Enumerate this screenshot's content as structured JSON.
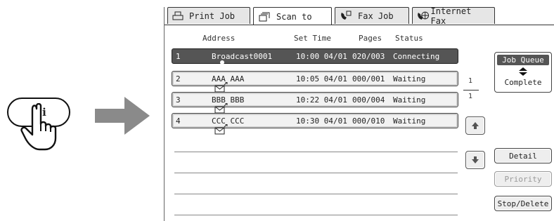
{
  "hint": {
    "dots": "··",
    "letter": "i"
  },
  "tabs": [
    {
      "label": "Print Job",
      "icon": "printer-icon"
    },
    {
      "label": "Scan to",
      "icon": "scanner-icon"
    },
    {
      "label": "Fax Job",
      "icon": "fax-icon"
    },
    {
      "label": "Internet Fax",
      "icon": "internet-fax-icon"
    }
  ],
  "columns": {
    "address": "Address",
    "set_time": "Set Time",
    "pages": "Pages",
    "status": "Status"
  },
  "jobs": [
    {
      "num": "1",
      "icon": "broadcast-icon",
      "address": "Broadcast0001",
      "time": "10:00 04/01",
      "pages": "020/003",
      "status": "Connecting"
    },
    {
      "num": "2",
      "icon": "email-icon",
      "address": "AAA AAA",
      "time": "10:05 04/01",
      "pages": "000/001",
      "status": "Waiting"
    },
    {
      "num": "3",
      "icon": "email-icon",
      "address": "BBB BBB",
      "time": "10:22 04/01",
      "pages": "000/004",
      "status": "Waiting"
    },
    {
      "num": "4",
      "icon": "email-icon",
      "address": "CCC CCC",
      "time": "10:30 04/01",
      "pages": "000/010",
      "status": "Waiting"
    }
  ],
  "pager": {
    "current": "1",
    "total": "1"
  },
  "job_queue": {
    "top": "Job Queue",
    "bottom": "Complete"
  },
  "buttons": {
    "detail": "Detail",
    "priority": "Priority",
    "stop_delete": "Stop/Delete"
  }
}
